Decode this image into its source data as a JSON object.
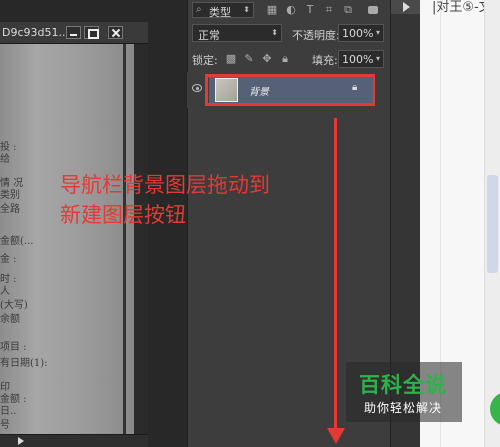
{
  "document": {
    "title": "D9c93d51...",
    "lines": [
      "...",
      "投 :",
      "给",
      "情 况",
      "类别",
      "全路",
      "...",
      "金额(...",
      "金 :",
      "时 :",
      "人",
      "(大写)",
      "余额",
      "...",
      "项目 :",
      "...",
      "有日期(1):",
      "...",
      "...",
      "印",
      "金额 :",
      "日..",
      "注..",
      "号"
    ]
  },
  "layers_panel": {
    "filter_select": "类型",
    "blend_mode": "正常",
    "opacity_label": "不透明度:",
    "opacity_value": "100%",
    "lock_label": "锁定:",
    "fill_label": "填充:",
    "fill_value": "100%",
    "layer": {
      "name": "背景",
      "locked": true,
      "visible": true
    }
  },
  "annotation": {
    "line1": "导航栏背景图层拖动到",
    "line2": "新建图层按钮"
  },
  "browser": {
    "fragment": "|对王⑤-文"
  },
  "watermark": {
    "title": "百科全说",
    "subtitle": "助你轻松解决"
  },
  "colors": {
    "highlight": "#e53935",
    "selected_layer": "#566076",
    "watermark_green": "#2db34a"
  }
}
